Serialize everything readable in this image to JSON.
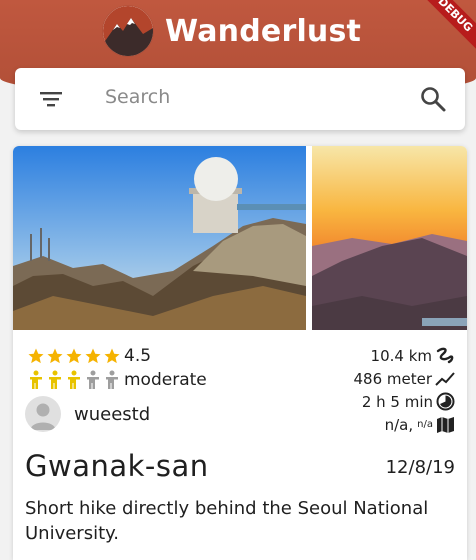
{
  "app": {
    "title": "Wanderlust",
    "debug_banner": "DEBUG"
  },
  "search": {
    "placeholder": "Search"
  },
  "hike": {
    "rating": 4.5,
    "rating_label": "4.5",
    "difficulty_level": 3,
    "difficulty_max": 5,
    "difficulty_label": "moderate",
    "username": "wueestd",
    "distance": "10.4 km",
    "elevation": "486 meter",
    "duration": "2 h 5 min",
    "season_a": "n/a,",
    "season_b": "n/a",
    "name": "Gwanak-san",
    "date": "12/8/19",
    "description": "Short hike directly behind the Seoul National University."
  },
  "colors": {
    "brand": "#b9543b",
    "star": "#f5b301",
    "person_active": "#e8c300",
    "person_inactive": "#9e9e9e"
  },
  "icons": [
    "filter-icon",
    "search-icon",
    "star-icon",
    "hiker-icon",
    "distance-icon",
    "elevation-icon",
    "clock-icon",
    "map-icon",
    "avatar-icon"
  ]
}
